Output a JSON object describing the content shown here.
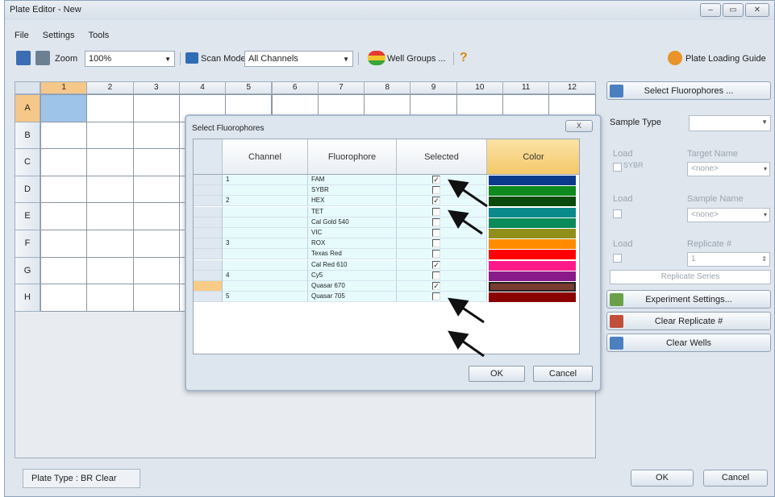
{
  "window": {
    "title": "Plate Editor - New",
    "controls": [
      "minimize",
      "maximize",
      "close"
    ]
  },
  "menu": [
    "File",
    "Settings",
    "Tools"
  ],
  "toolbar": {
    "zoom_label": "Zoom",
    "zoom_value": "100%",
    "scan_mode_label": "Scan Mode",
    "scan_mode_value": "All Channels",
    "well_groups_label": "Well Groups ...",
    "help_label": "?",
    "plate_loading_guide_label": "Plate Loading Guide"
  },
  "grid": {
    "columns": [
      "1",
      "2",
      "3",
      "4",
      "5",
      "6",
      "7",
      "8",
      "9",
      "10",
      "11",
      "12"
    ],
    "rows": [
      "A",
      "B",
      "C",
      "D",
      "E",
      "F",
      "G",
      "H"
    ],
    "selected_well": "A1"
  },
  "right_panel": {
    "select_fluorophores_label": "Select Fluorophores ...",
    "sample_type_label": "Sample Type",
    "sample_type_value": "",
    "load_label_1": "Load",
    "target_name_label": "Target Name",
    "sybr_label": "SYBR",
    "target_name_value": "<none>",
    "load_label_2": "Load",
    "sample_name_label": "Sample Name",
    "sample_name_value": "<none>",
    "load_label_3": "Load",
    "replicate_label": "Replicate #",
    "replicate_value": "1",
    "replicate_series_label": "Replicate Series",
    "experiment_settings_label": "Experiment Settings...",
    "clear_replicate_label": "Clear Replicate #",
    "clear_wells_label": "Clear Wells"
  },
  "status": {
    "plate_type": "Plate Type : BR Clear"
  },
  "bottom_buttons": {
    "ok": "OK",
    "cancel": "Cancel"
  },
  "dialog": {
    "title": "Select Fluorophores",
    "close_label": "X",
    "headers": {
      "channel": "Channel",
      "fluorophore": "Fluorophore",
      "selected": "Selected",
      "color": "Color"
    },
    "rows": [
      {
        "channel": "1",
        "fluorophore": "FAM",
        "selected": true,
        "color": "#0a3a8c"
      },
      {
        "channel": "",
        "fluorophore": "SYBR",
        "selected": false,
        "color": "#0e8a1e"
      },
      {
        "channel": "2",
        "fluorophore": "HEX",
        "selected": true,
        "color": "#0b4a0d"
      },
      {
        "channel": "",
        "fluorophore": "TET",
        "selected": false,
        "color": "#0a8a8a"
      },
      {
        "channel": "",
        "fluorophore": "Cal Gold 540",
        "selected": false,
        "color": "#0b8a5a"
      },
      {
        "channel": "",
        "fluorophore": "VIC",
        "selected": false,
        "color": "#8f8f1a"
      },
      {
        "channel": "3",
        "fluorophore": "ROX",
        "selected": false,
        "color": "#ff8c00"
      },
      {
        "channel": "",
        "fluorophore": "Texas Red",
        "selected": false,
        "color": "#ff0000"
      },
      {
        "channel": "",
        "fluorophore": "Cal Red 610",
        "selected": true,
        "color": "#ff1a8c"
      },
      {
        "channel": "4",
        "fluorophore": "Cy5",
        "selected": false,
        "color": "#8a1a8a"
      },
      {
        "channel": "",
        "fluorophore": "Quasar 670",
        "selected": true,
        "color": "#7a3b30"
      },
      {
        "channel": "5",
        "fluorophore": "Quasar 705",
        "selected": false,
        "color": "#8b0000"
      }
    ],
    "selected_row": 10,
    "ok_label": "OK",
    "cancel_label": "Cancel"
  }
}
